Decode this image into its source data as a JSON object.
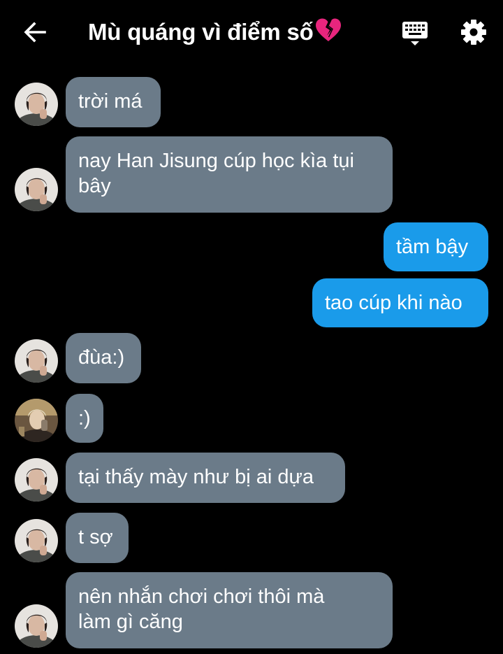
{
  "header": {
    "title": "Mù quáng vì điểm số",
    "title_emoji": "broken-heart",
    "back_icon": "arrow-left-icon",
    "keyboard_icon": "keyboard-icon",
    "settings_icon": "gear-icon"
  },
  "colors": {
    "background": "#000000",
    "incoming_bubble": "#6b7b89",
    "outgoing_bubble": "#1a9bea",
    "broken_heart": "#e8257d"
  },
  "messages": [
    {
      "side": "in",
      "avatar": "avatar-a",
      "lines": [
        "trời má"
      ]
    },
    {
      "side": "in",
      "avatar": "avatar-a",
      "lines": [
        "nay Han Jisung cúp học kìa tụi",
        "bây"
      ]
    },
    {
      "side": "out",
      "lines": [
        "tầm bậy"
      ]
    },
    {
      "side": "out",
      "lines": [
        "tao cúp khi nào"
      ]
    },
    {
      "side": "in",
      "avatar": "avatar-a",
      "lines": [
        "đùa:)"
      ]
    },
    {
      "side": "in",
      "avatar": "avatar-b",
      "lines": [
        ":)"
      ]
    },
    {
      "side": "in",
      "avatar": "avatar-a",
      "lines": [
        "tại thấy mày như bị ai dựa"
      ]
    },
    {
      "side": "in",
      "avatar": "avatar-a",
      "lines": [
        "t sợ"
      ]
    },
    {
      "side": "in",
      "avatar": "avatar-a",
      "lines": [
        "nên nhắn chơi chơi thôi mà",
        "làm gì căng"
      ]
    }
  ]
}
